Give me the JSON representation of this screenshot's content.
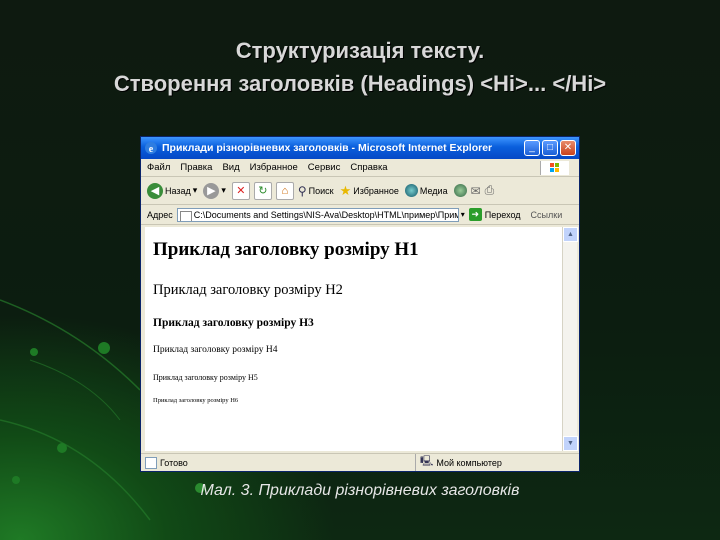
{
  "slide": {
    "title_line1": "Структуризація тексту.",
    "title_line2": "Створення заголовків (Headings) <Hi>... </Hi>",
    "caption": "Мал. 3. Приклади різнорівневих заголовків"
  },
  "browser": {
    "window_title": "Приклади різнорівневих заголовків - Microsoft Internet Explorer",
    "menu": [
      "Файл",
      "Правка",
      "Вид",
      "Избранное",
      "Сервис",
      "Справка"
    ],
    "toolbar": {
      "back": "Назад",
      "search": "Поиск",
      "favorites": "Избранное",
      "media": "Медиа"
    },
    "address": {
      "label": "Адрес",
      "value": "C:\\Documents and Settings\\NIS-Ava\\Desktop\\HTML\\пример\\Пример9.ht",
      "go": "Переход",
      "links": "Ссылки"
    },
    "headings": [
      "Приклад заголовку розміру H1",
      "Приклад заголовку розміру H2",
      "Приклад заголовку розміру H3",
      "Приклад заголовку розміру H4",
      "Приклад заголовку розміру H5",
      "Приклад заголовку розміру H6"
    ],
    "status": {
      "left": "Готово",
      "right": "Мой компьютер"
    }
  },
  "colors": {
    "title_text": "#d8d8d8",
    "titlebar_blue": "#0a5fdc",
    "background_green": "#114a16"
  }
}
